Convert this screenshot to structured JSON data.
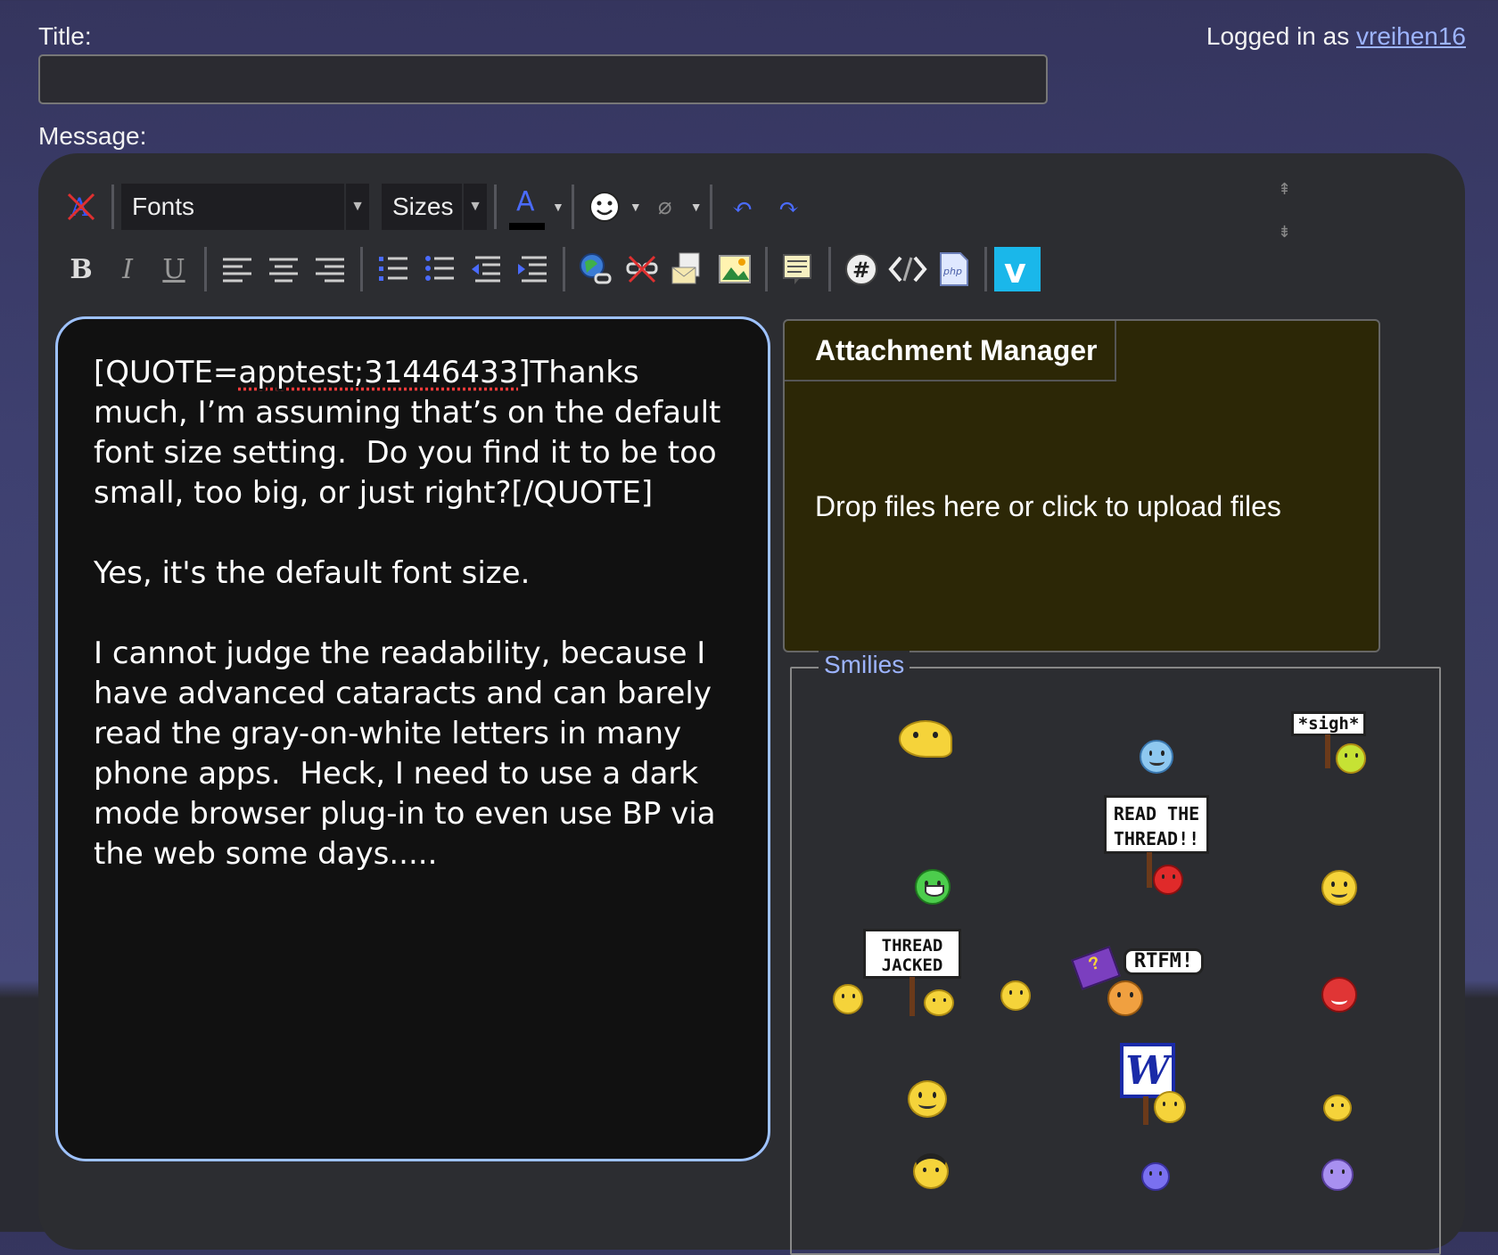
{
  "form": {
    "title_label": "Title:",
    "title_value": "",
    "message_label": "Message:",
    "login_prefix": "Logged in as",
    "username": "vreihen16"
  },
  "toolbar": {
    "fonts_label": "Fonts",
    "sizes_label": "Sizes",
    "row1_icons": [
      "remove-format-icon",
      "font-color-icon",
      "smiley-icon",
      "attachment-icon",
      "undo-icon",
      "redo-icon"
    ],
    "row2_icons": [
      "bold-icon",
      "italic-icon",
      "underline-icon",
      "align-left-icon",
      "align-center-icon",
      "align-right-icon",
      "ordered-list-icon",
      "unordered-list-icon",
      "outdent-icon",
      "indent-icon",
      "insert-link-icon",
      "unlink-icon",
      "insert-email-icon",
      "insert-image-icon",
      "quote-icon",
      "hashtag-icon",
      "code-icon",
      "php-icon",
      "vimeo-icon"
    ],
    "bold_glyph": "B",
    "italic_glyph": "I",
    "underline_glyph": "U"
  },
  "message": {
    "quote_open": "[QUOTE=",
    "quote_author": "apptest;31446433",
    "quote_body": "]Thanks much, I’m assuming that’s on the default font size setting.  Do you find it to be too small, too big, or just right?[/QUOTE]",
    "paragraph2": "Yes, it's the default font size.",
    "paragraph3": "I cannot judge the readability, because I have advanced cataracts and can barely read the gray-on-white letters in many phone apps.  Heck, I need to use a dark mode browser plug-in to even use BP via the web some days....."
  },
  "attachments": {
    "tab_label": "Attachment Manager",
    "drop_text": "Drop files here or click to upload files"
  },
  "smilies": {
    "legend": "Smilies",
    "sign_sigh": "*sigh*",
    "sign_read_thread_1": "READ THE",
    "sign_read_thread_2": "THREAD!!",
    "sign_thread_jacked_1": "THREAD",
    "sign_thread_jacked_2": "JACKED",
    "sign_rtfm": "RTFM!",
    "word_logo": "W",
    "book_glyph": "?"
  },
  "colors": {
    "link": "#9db4ff",
    "accent_border": "#9ec2ff",
    "attach_bg": "#2c2706"
  }
}
